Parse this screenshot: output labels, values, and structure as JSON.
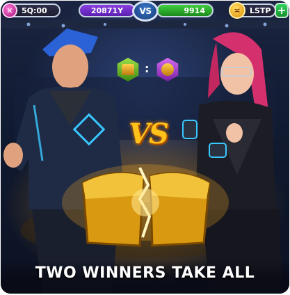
{
  "topbar": {
    "left_pill": {
      "icon": "gem-icon",
      "value": "5Q:00"
    },
    "player1": {
      "score": "20871Y",
      "color": "#7a35d6"
    },
    "vs_label": "VS",
    "player2": {
      "score": "9914",
      "color": "#2bb02b"
    },
    "right_pill": {
      "icon": "angry-face-icon",
      "label": "LSTP"
    },
    "plus_icon": "plus-icon"
  },
  "center": {
    "left_hex_icon": "treasure-chest-icon",
    "right_hex_icon": "coin-icon",
    "separator": ":",
    "vs_text": "VS"
  },
  "characters": {
    "left": "blue-haired-male-fighter",
    "right": "pink-haired-female-fighter"
  },
  "reward": {
    "icon": "split-golden-chest"
  },
  "footer": {
    "title": "TWO WINNERS TAKE ALL"
  }
}
